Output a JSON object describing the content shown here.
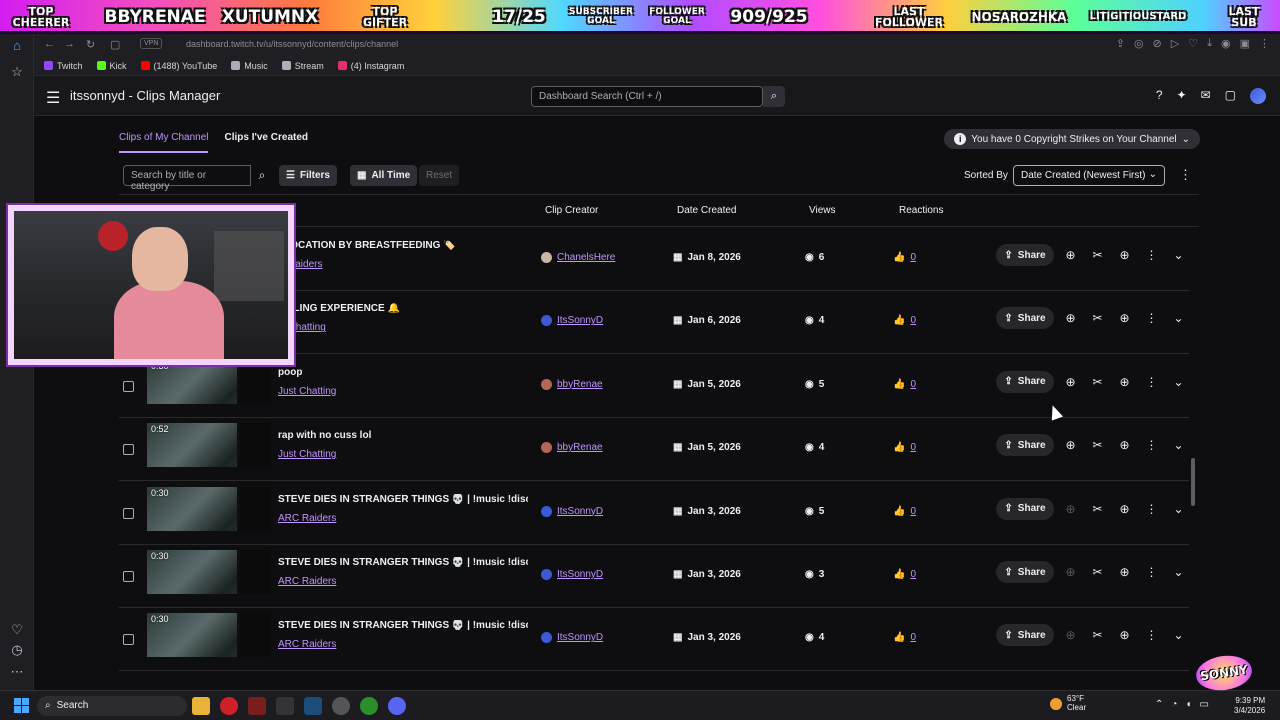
{
  "overlay": {
    "top_cheerer_label": "TOP\nCHEERER",
    "top_cheerer_1": "BBYRENAE",
    "top_cheerer_2": "XUTUMNX",
    "top_gifter_label": "TOP\nGIFTER",
    "sub_goal": "17/25",
    "sub_goal_label": "SUBSCRIBER GOAL",
    "follower_goal_label": "FOLLOWER GOAL",
    "follower_goal": "909/925",
    "last_follower_label": "LAST FOLLOWER",
    "last_follower": "NOSAROZHKA",
    "last_sub_name": "LITIGITIOUSTARD",
    "last_sub_label": "LAST SUB"
  },
  "browser": {
    "vpn": "VPN",
    "url": "dashboard.twitch.tv/u/itssonnyd/content/clips/channel",
    "bookmarks": [
      {
        "label": "Twitch",
        "color": "#9146ff"
      },
      {
        "label": "Kick",
        "color": "#53fc18"
      },
      {
        "label": "(1488) YouTube",
        "color": "#ff0000"
      },
      {
        "label": "Music",
        "color": "#adadb8"
      },
      {
        "label": "Stream",
        "color": "#adadb8"
      },
      {
        "label": "(4) Instagram",
        "color": "#e1306c"
      }
    ]
  },
  "header": {
    "title": "itssonnyd - Clips Manager",
    "search_placeholder": "Dashboard Search (Ctrl + /)"
  },
  "tabs": [
    "Clips of My Channel",
    "Clips I've Created"
  ],
  "strikes": "You have 0 Copyright Strikes on Your Channel",
  "filters": {
    "search_placeholder": "Search by title or category",
    "filters_label": "Filters",
    "time_label": "All Time",
    "reset_label": "Reset",
    "sorted_by_label": "Sorted By",
    "sort_value": "Date Created (Newest First)"
  },
  "columns": [
    "Clip Creator",
    "Date Created",
    "Views",
    "Reactions"
  ],
  "clips": [
    {
      "duration": "",
      "title": "FFOCATION BY BREASTFEEDING 🏷️",
      "category": "C Raiders",
      "creator": "ChanelsHere",
      "avatar_color": "#c9b5a5",
      "date": "Jan 8, 2026",
      "views": "6",
      "reactions": "0"
    },
    {
      "duration": "",
      "title": "MBLING EXPERIENCE 🔔",
      "category": "st Chatting",
      "creator": "ItsSonnyD",
      "avatar_color": "#3b5bd6",
      "date": "Jan 6, 2026",
      "views": "4",
      "reactions": "0"
    },
    {
      "duration": "0:30",
      "title": "poop",
      "category": "Just Chatting",
      "creator": "bbyRenae",
      "avatar_color": "#b5665a",
      "date": "Jan 5, 2026",
      "views": "5",
      "reactions": "0"
    },
    {
      "duration": "0:52",
      "title": "rap with no cuss lol",
      "category": "Just Chatting",
      "creator": "bbyRenae",
      "avatar_color": "#b5665a",
      "date": "Jan 5, 2026",
      "views": "4",
      "reactions": "0"
    },
    {
      "duration": "0:30",
      "title": "STEVE DIES IN STRANGER THINGS 💀 | !music !disco...",
      "category": "ARC Raiders",
      "creator": "ItsSonnyD",
      "avatar_color": "#3b5bd6",
      "date": "Jan 3, 2026",
      "views": "5",
      "reactions": "0"
    },
    {
      "duration": "0:30",
      "title": "STEVE DIES IN STRANGER THINGS 💀 | !music !disco...",
      "category": "ARC Raiders",
      "creator": "ItsSonnyD",
      "avatar_color": "#3b5bd6",
      "date": "Jan 3, 2026",
      "views": "3",
      "reactions": "0"
    },
    {
      "duration": "0:30",
      "title": "STEVE DIES IN STRANGER THINGS 💀 | !music !disco...",
      "category": "ARC Raiders",
      "creator": "ItsSonnyD",
      "avatar_color": "#3b5bd6",
      "date": "Jan 3, 2026",
      "views": "4",
      "reactions": "0"
    }
  ],
  "row_actions": {
    "share_label": "Share"
  },
  "taskbar": {
    "search_label": "Search",
    "temp": "63°F",
    "weather": "Clear",
    "time": "9:39 PM",
    "date": "3/4/2026"
  },
  "watermark": "SONNY"
}
